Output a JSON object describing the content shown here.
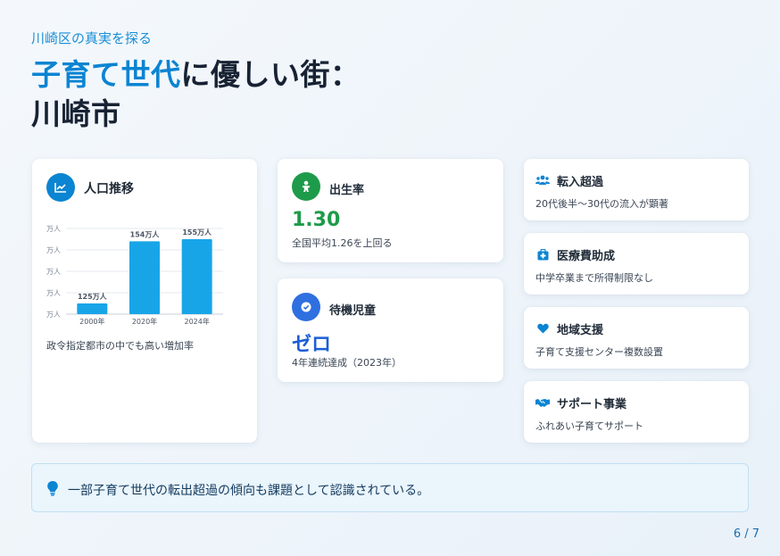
{
  "header": {
    "subtitle": "川崎区の真実を探る",
    "title_accent": "子育て世代",
    "title_rest": "に優しい街：",
    "title_line2": "川崎市"
  },
  "population_card": {
    "label": "人口推移",
    "icon": "line-chart-icon",
    "caption": "政令指定都市の中でも高い増加率"
  },
  "chart_data": {
    "type": "bar",
    "categories": [
      "2000年",
      "2020年",
      "2024年"
    ],
    "values": [
      125,
      154,
      155
    ],
    "data_labels": [
      "125万人",
      "154万人",
      "155万人"
    ],
    "y_tick_labels": [
      "万人",
      "万人",
      "万人",
      "万人",
      "万人"
    ],
    "title": "",
    "xlabel": "",
    "ylabel": "",
    "ylim": [
      120,
      160
    ],
    "grid": true,
    "bar_color": "#18a5e8"
  },
  "birth_rate_card": {
    "label": "出生率",
    "value": "1.30",
    "description": "全国平均1.26を上回る",
    "icon": "baby-icon",
    "value_color": "#1e9b4a",
    "icon_color": "#1e9b4a"
  },
  "waiting_children_card": {
    "label": "待機児童",
    "value": "ゼロ",
    "description": "4年連続達成（2023年）",
    "icon": "check-circle-icon",
    "value_color": "#1d5fd6",
    "icon_color": "#2f6fe0"
  },
  "side_cards": [
    {
      "label": "転入超過",
      "description": "20代後半〜30代の流入が顕著",
      "icon": "users-icon"
    },
    {
      "label": "医療費助成",
      "description": "中学卒業まで所得制限なし",
      "icon": "medical-kit-icon"
    },
    {
      "label": "地域支援",
      "description": "子育て支援センター複数設置",
      "icon": "heart-icon"
    },
    {
      "label": "サポート事業",
      "description": "ふれあい子育てサポート",
      "icon": "handshake-icon"
    }
  ],
  "note": {
    "text": "一部子育て世代の転出超過の傾向も課題として認識されている。",
    "icon": "lightbulb-icon"
  },
  "page_number": "6 / 7",
  "colors": {
    "accent": "#0b84d2",
    "icon_blue": "#0b84d2"
  }
}
